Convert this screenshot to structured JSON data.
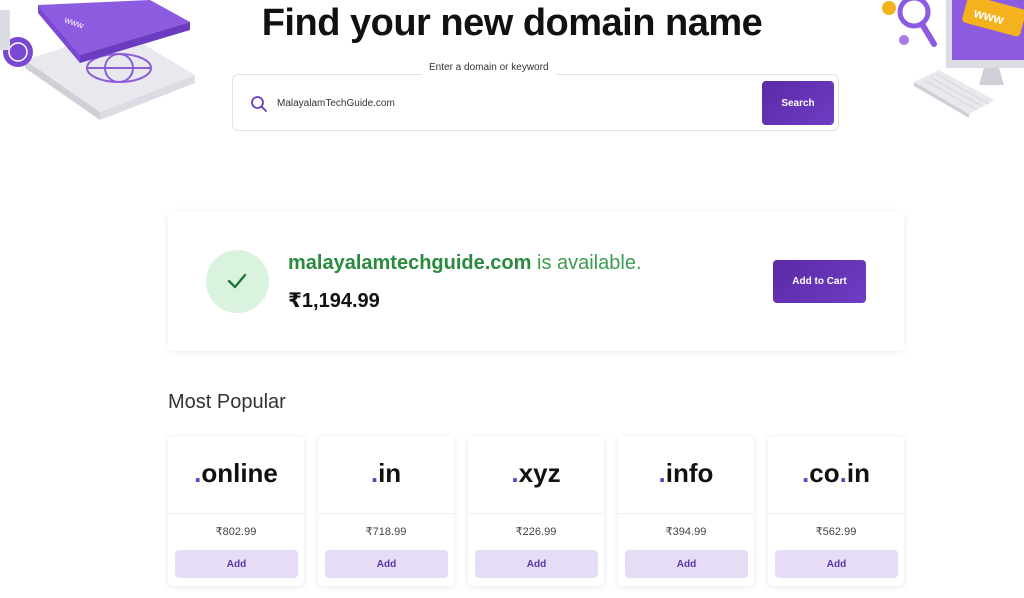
{
  "hero": {
    "title": "Find your new domain name"
  },
  "search": {
    "label": "Enter a domain or keyword",
    "value": "MalayalamTechGuide.com",
    "button_label": "Search"
  },
  "result": {
    "domain": "malayalamtechguide.com",
    "status": " is available.",
    "price": "₹1,194.99",
    "cart_label": "Add to Cart"
  },
  "popular": {
    "title": "Most Popular",
    "items": [
      {
        "dot": ".",
        "name": "online",
        "price": "₹802.99",
        "add_label": "Add"
      },
      {
        "dot": ".",
        "name": "in",
        "price": "₹718.99",
        "add_label": "Add"
      },
      {
        "dot": ".",
        "name": "xyz",
        "price": "₹226.99",
        "add_label": "Add"
      },
      {
        "dot": ".",
        "name": "info",
        "price": "₹394.99",
        "add_label": "Add"
      },
      {
        "dot": ".",
        "name": "co",
        "dot2": ".",
        "name2": "in",
        "price": "₹562.99",
        "add_label": "Add"
      }
    ]
  },
  "illustrations": {
    "left_badge": "www",
    "right_badge": "www"
  },
  "colors": {
    "accent": "#6a3bc4",
    "available_green": "#2a8a3e",
    "add_button_bg": "#e6dcf6"
  }
}
